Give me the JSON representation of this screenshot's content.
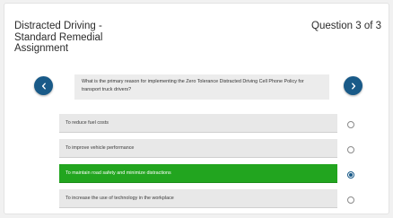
{
  "header": {
    "title": "Distracted Driving - Standard Remedial Assignment",
    "counter": "Question 3 of 3"
  },
  "navigation": {
    "prev_icon": "chevron-left-icon",
    "next_icon": "chevron-right-icon",
    "button_color": "#195a88"
  },
  "question": {
    "text": "What is the primary reason for implementing the Zero Tolerance Distracted Driving Cell Phone Policy for transport truck drivers?"
  },
  "options": [
    {
      "label": "To reduce fuel costs",
      "selected": false
    },
    {
      "label": "To improve vehicle performance",
      "selected": false
    },
    {
      "label": "To maintain road safety and minimize distractions",
      "selected": true
    },
    {
      "label": "To increase the use of technology in the workplace",
      "selected": false
    }
  ],
  "colors": {
    "selected_option": "#22a51f",
    "option_bg": "#e8e8e8"
  }
}
